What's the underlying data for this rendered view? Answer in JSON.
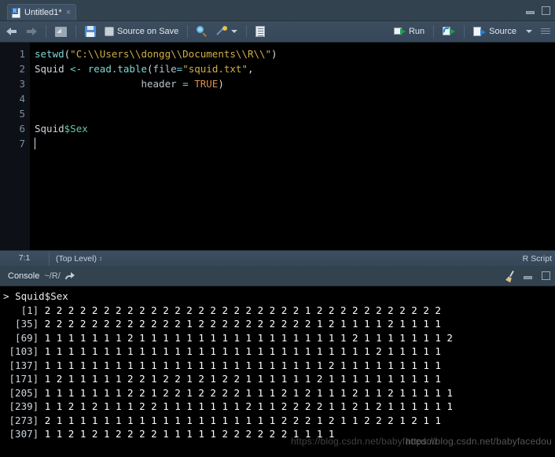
{
  "source_pane": {
    "tab": {
      "title": "Untitled1*",
      "close_label": "×",
      "icon": "r-document-icon"
    },
    "window_controls": {
      "minimize": "minimize-icon",
      "maximize": "maximize-icon"
    },
    "toolbar": {
      "back_label": "back-arrow-icon",
      "forward_label": "forward-arrow-icon",
      "popout_label": "show-in-new-window-icon",
      "save_label": "save-icon",
      "source_on_save_label": "Source on Save",
      "find_label": "find-replace-icon",
      "codetools_label": "code-tools-icon",
      "outline_label": "document-outline-icon",
      "run_label": "Run",
      "rerun_label": "re-run-icon",
      "source_button_label": "Source",
      "source_menu_caret": "▾",
      "more_label": "pane-menu-icon"
    },
    "editor": {
      "line_numbers": [
        "1",
        "2",
        "3",
        "4",
        "5",
        "6",
        "7"
      ],
      "lines": [
        {
          "tokens": [
            {
              "t": "setwd",
              "c": "tok-fn"
            },
            {
              "t": "(",
              "c": "tok-punc"
            },
            {
              "t": "\"C:\\\\Users\\\\dongg\\\\Documents\\\\R\\\\\"",
              "c": "tok-str"
            },
            {
              "t": ")",
              "c": "tok-punc"
            }
          ]
        },
        {
          "tokens": [
            {
              "t": "Squid ",
              "c": "tok-var"
            },
            {
              "t": "<-",
              "c": "tok-op"
            },
            {
              "t": " ",
              "c": "tok-var"
            },
            {
              "t": "read.table",
              "c": "tok-fn"
            },
            {
              "t": "(",
              "c": "tok-punc"
            },
            {
              "t": "file",
              "c": "tok-arg"
            },
            {
              "t": "=",
              "c": "tok-op"
            },
            {
              "t": "\"squid.txt\"",
              "c": "tok-str"
            },
            {
              "t": ",",
              "c": "tok-punc"
            }
          ]
        },
        {
          "tokens": [
            {
              "t": "                  ",
              "c": "tok-var"
            },
            {
              "t": "header",
              "c": "tok-arg"
            },
            {
              "t": " ",
              "c": "tok-var"
            },
            {
              "t": "=",
              "c": "tok-op"
            },
            {
              "t": " ",
              "c": "tok-var"
            },
            {
              "t": "TRUE",
              "c": "tok-const"
            },
            {
              "t": ")",
              "c": "tok-punc"
            }
          ]
        },
        {
          "tokens": []
        },
        {
          "tokens": []
        },
        {
          "tokens": [
            {
              "t": "Squid",
              "c": "tok-var"
            },
            {
              "t": "$",
              "c": "tok-dollar"
            },
            {
              "t": "Sex",
              "c": "tok-dollar"
            }
          ]
        },
        {
          "tokens": [],
          "caret": true
        }
      ]
    },
    "status_bar": {
      "cursor_position": "7:1",
      "scope": "(Top Level)",
      "scope_caret": "↕",
      "file_type": "R Script"
    }
  },
  "console_pane": {
    "header": {
      "title": "Console",
      "path": "~/R/",
      "popout_icon": "popout-arrow-icon",
      "clear_icon": "broom-clear-console-icon",
      "minimize": "minimize-icon",
      "maximize": "maximize-icon"
    },
    "output": {
      "prompt": ">",
      "command": "Squid$Sex",
      "rows": [
        {
          "index": "[1]",
          "values": "2 2 2 2 2 2 2 2 2 2 2 2 2 2 2 2 2 2 2 2 2 2 1 2 2 2 2 2 2 2 2 2 2 2"
        },
        {
          "index": "[35]",
          "values": "2 2 2 2 2 2 2 2 2 2 2 2 1 2 2 2 2 2 2 2 2 2 2 1 2 1 1 1 1 2 1 1 1 1"
        },
        {
          "index": "[69]",
          "values": "1 1 1 1 1 1 1 2 1 1 1 1 1 1 1 1 1 1 1 1 1 1 1 1 1 1 2 1 1 1 1 1 1 1 2"
        },
        {
          "index": "[103]",
          "values": "1 1 1 1 1 1 1 1 1 1 1 1 1 1 1 1 1 1 1 1 1 1 1 1 1 1 1 1 2 1 1 1 1 1"
        },
        {
          "index": "[137]",
          "values": "1 1 1 1 1 1 1 1 1 1 1 1 1 1 1 1 1 1 1 1 1 1 1 1 2 1 1 1 1 1 1 1 1 1"
        },
        {
          "index": "[171]",
          "values": "1 2 1 1 1 1 1 2 2 1 2 2 1 2 1 2 2 1 1 1 1 1 1 2 1 1 1 1 1 1 1 1 1 1"
        },
        {
          "index": "[205]",
          "values": "1 1 1 1 1 1 1 2 2 1 2 2 1 2 2 2 2 1 1 1 2 1 2 1 1 1 2 1 1 2 1 1 1 1 1"
        },
        {
          "index": "[239]",
          "values": "1 1 2 1 2 1 1 1 2 2 1 1 1 1 1 1 1 2 1 1 2 2 2 2 1 1 2 1 2 1 1 1 1 1 1"
        },
        {
          "index": "[273]",
          "values": "2 1 1 1 1 1 1 1 1 1 1 1 1 1 1 1 1 1 1 1 2 2 2 1 2 1 1 2 2 2 1 2 1 1"
        },
        {
          "index": "[307]",
          "values": "1 1 2 1 2 1 2 2 2 2 1 1 1 1 1 2 2 2 2 2 2 1 1 1 1"
        }
      ]
    }
  },
  "watermark": {
    "text": "https://blog.csdn.net/babyfacedou",
    "text2": "https://blog.csdn.net/babyfacedou"
  }
}
